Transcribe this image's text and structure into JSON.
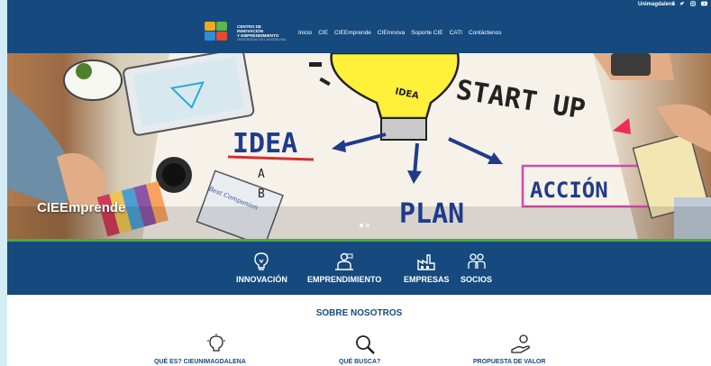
{
  "topbar": {
    "site_link": "Unimagdalena",
    "social": [
      "f",
      "t",
      "ig",
      "yt"
    ]
  },
  "logo": {
    "line1": "CENTRO DE",
    "line2": "INNOVACIÓN",
    "line3": "Y EMPRENDIMIENTO",
    "line4": "UNIVERSIDAD DEL MAGDALENA"
  },
  "nav": {
    "items": [
      "Inicio",
      "CIE",
      "CIEEmprende",
      "CIEInnova",
      "Soporte CIE",
      "CATI",
      "Contáctenos"
    ]
  },
  "hero": {
    "caption": "CIEEmprende",
    "board_words": {
      "idea": "IDEA",
      "a": "A",
      "b": "B",
      "plan": "PLAN",
      "startup": "START UP",
      "accion": "ACCIÓN",
      "notebook": "Best Companion",
      "bulb": "IDEA"
    },
    "slide_count": 2,
    "active_slide": 1
  },
  "features": [
    {
      "label": "INNOVACIÓN",
      "icon": "bulb-icon"
    },
    {
      "label": "EMPRENDIMIENTO",
      "icon": "entrepreneur-icon"
    },
    {
      "label": "EMPRESAS",
      "icon": "factory-icon"
    },
    {
      "label": "SOCIOS",
      "icon": "partners-icon"
    }
  ],
  "sobre": {
    "title": "SOBRE NOSOTROS",
    "items": [
      {
        "label": "QUÉ ES? CIEUNIMAGDALENA",
        "icon": "bulb-icon"
      },
      {
        "label": "QUÉ BUSCA?",
        "icon": "magnifier-icon"
      },
      {
        "label": "PROPUESTA DE VALOR",
        "icon": "value-hand-icon"
      }
    ]
  },
  "colors": {
    "primary": "#164a7e",
    "accent_green": "#4caa43",
    "background_side": "#d3ecf6"
  }
}
